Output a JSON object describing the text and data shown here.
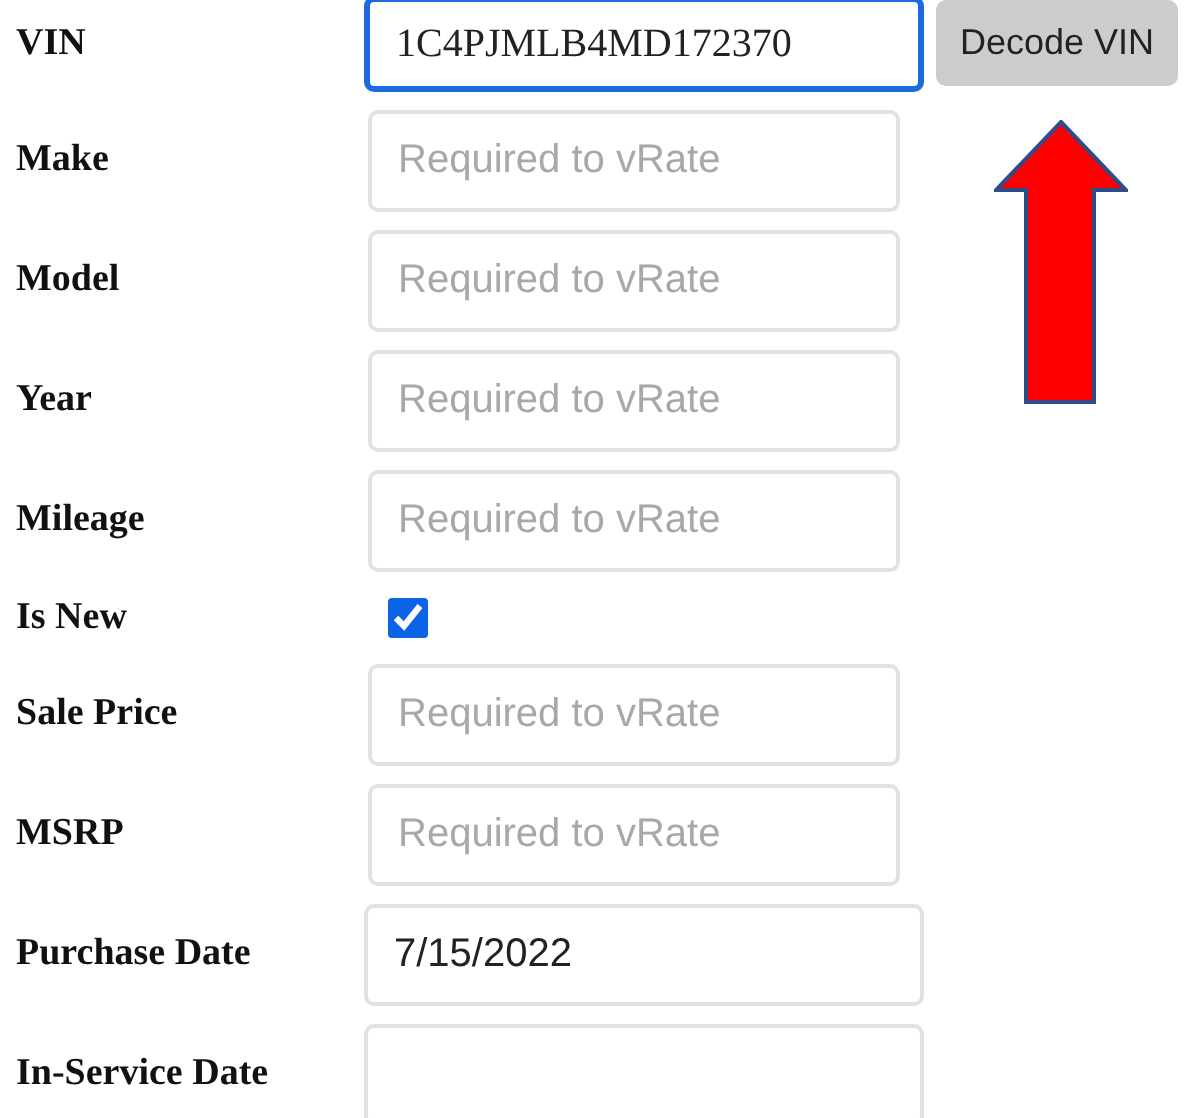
{
  "rows": [
    {
      "kind": "text",
      "label": "VIN",
      "value": "1C4PJMLB4MD172370",
      "focused": true
    },
    {
      "kind": "text",
      "label": "Make",
      "placeholder": "Required to vRate",
      "focused": false
    },
    {
      "kind": "text",
      "label": "Model",
      "placeholder": "Required to vRate",
      "focused": false
    },
    {
      "kind": "text",
      "label": "Year",
      "placeholder": "Required to vRate",
      "focused": false
    },
    {
      "kind": "text",
      "label": "Mileage",
      "placeholder": "Required to vRate",
      "focused": false
    },
    {
      "kind": "checkbox",
      "label": "Is New",
      "checked": true
    },
    {
      "kind": "text",
      "label": "Sale Price",
      "placeholder": "Required to vRate",
      "focused": false
    },
    {
      "kind": "text",
      "label": "MSRP",
      "placeholder": "Required to vRate",
      "focused": false
    },
    {
      "kind": "text",
      "label": "Purchase Date",
      "value": "7/15/2022",
      "focused": false
    },
    {
      "kind": "text",
      "label": "In-Service Date",
      "focused": false
    }
  ],
  "decode_button": {
    "label": "Decode VIN"
  }
}
